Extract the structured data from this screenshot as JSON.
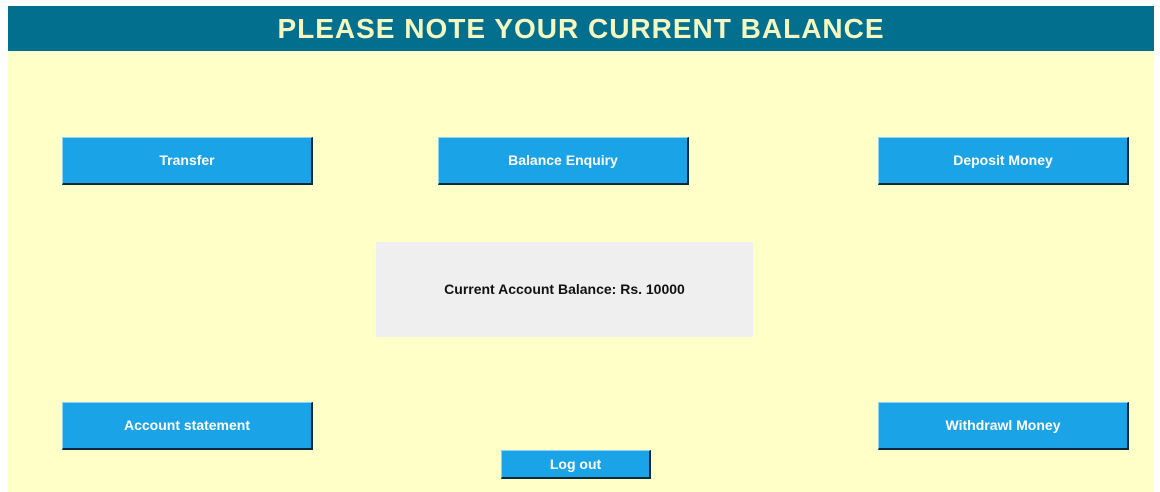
{
  "header": {
    "title": "PLEASE NOTE YOUR CURRENT BALANCE"
  },
  "buttons": {
    "transfer": "Transfer",
    "balance_enquiry": "Balance Enquiry",
    "deposit_money": "Deposit Money",
    "account_statement": "Account statement",
    "withdrawl_money": "Withdrawl Money",
    "log_out": "Log out"
  },
  "balance": {
    "text": "Current Account Balance: Rs. 10000"
  },
  "colors": {
    "header_bg": "#036f8f",
    "header_text": "#f4f7c0",
    "page_bg": "#ffffc8",
    "button_bg": "#1aa3e6",
    "button_text": "#ffffff",
    "panel_bg": "#efefef"
  }
}
